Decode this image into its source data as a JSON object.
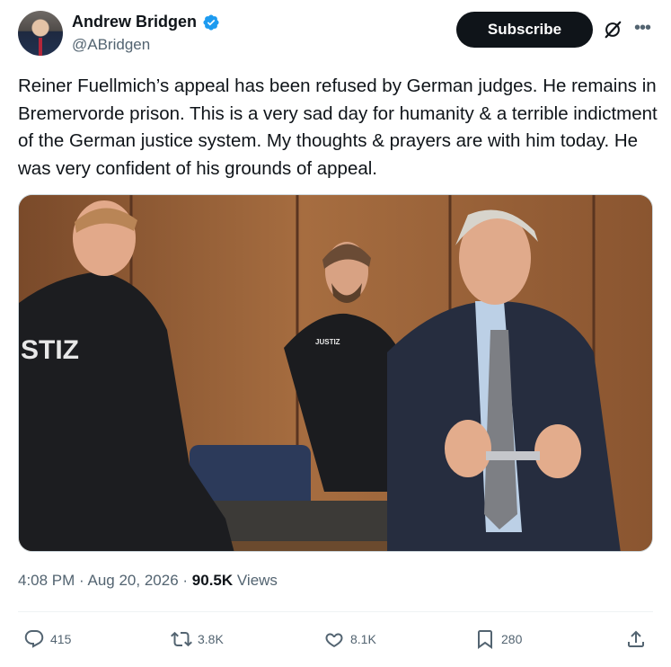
{
  "author": {
    "display_name": "Andrew Bridgen",
    "handle": "@ABridgen",
    "verified": true,
    "verified_color": "#1d9bf0"
  },
  "header": {
    "subscribe_label": "Subscribe",
    "grok_icon": "grok-slash-icon",
    "more_icon": "more-dots-icon"
  },
  "tweet": {
    "text": "Reiner Fuellmich’s appeal has been refused by German judges. He remains in Bremervorde prison. This is a very sad day for humanity & a terrible indictment of the German justice system.  My thoughts & prayers are with him today. He was very confident of his grounds of appeal.",
    "media": {
      "kind": "photo",
      "vest_text_left": "STIZ",
      "vest_text_center": "JUSTIZ"
    },
    "time": "4:08 PM",
    "date": "Aug 20, 2026",
    "views_count": "90.5K",
    "views_label": "Views"
  },
  "actions": {
    "replies": "415",
    "reposts": "3.8K",
    "likes": "8.1K",
    "bookmarks": "280"
  },
  "colors": {
    "text_primary": "#0f1419",
    "text_secondary": "#536471",
    "button_dark": "#0f1419"
  }
}
